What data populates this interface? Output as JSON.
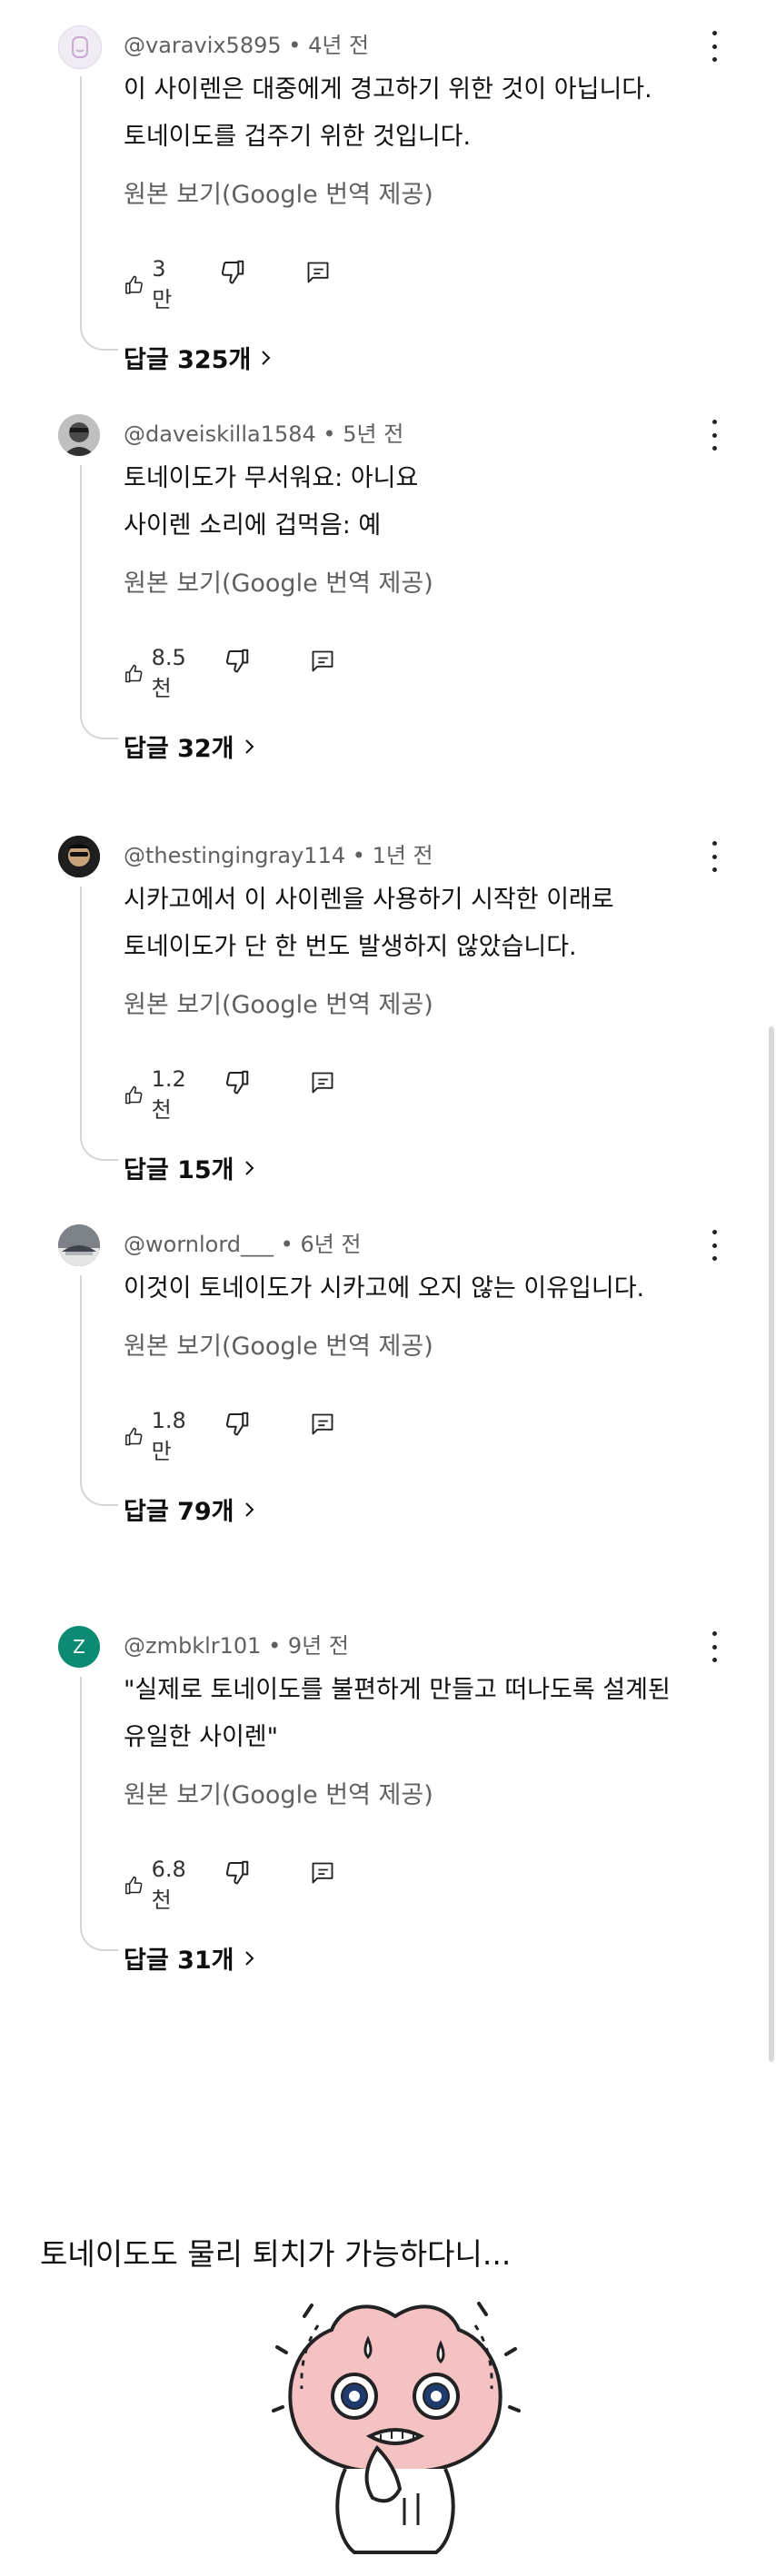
{
  "comments": [
    {
      "handle": "@varavix5895",
      "age": "4년 전",
      "lines": [
        "이 사이렌은 대중에게 경고하기 위한 것이 아닙니다.",
        "토네이도를 겁주기 위한 것입니다."
      ],
      "translate_label": "원본 보기(Google 번역 제공)",
      "likes": "3만",
      "replies_label": "답글 325개"
    },
    {
      "handle": "@daveiskilla1584",
      "age": "5년 전",
      "lines": [
        "토네이도가 무서워요: 아니요",
        "사이렌 소리에 겁먹음: 예"
      ],
      "translate_label": "원본 보기(Google 번역 제공)",
      "likes": "8.5천",
      "replies_label": "답글 32개"
    },
    {
      "handle": "@thestingingray114",
      "age": "1년 전",
      "lines": [
        "시카고에서 이 사이렌을 사용하기 시작한 이래로",
        "토네이도가 단 한 번도 발생하지 않았습니다."
      ],
      "translate_label": "원본 보기(Google 번역 제공)",
      "likes": "1.2천",
      "replies_label": "답글 15개"
    },
    {
      "handle": "@wornlord___",
      "age": "6년 전",
      "lines": [
        "이것이 토네이도가 시카고에 오지 않는 이유입니다."
      ],
      "translate_label": "원본 보기(Google 번역 제공)",
      "likes": "1.8만",
      "replies_label": "답글 79개"
    },
    {
      "handle": "@zmbklr101",
      "age": "9년 전",
      "avatar_letter": "Z",
      "lines": [
        "\"실제로 토네이도를 불편하게 만들고 떠나도록 설계된",
        "유일한 사이렌\""
      ],
      "translate_label": "원본 보기(Google 번역 제공)",
      "likes": "6.8천",
      "replies_label": "답글 31개"
    }
  ],
  "caption": "토네이도도 물리 퇴치가 가능하다니...",
  "icons": {
    "like": "thumbs-up-icon",
    "dislike": "thumbs-down-icon",
    "reply": "reply-icon",
    "menu": "more-vert-icon",
    "chevron": "chevron-right-icon"
  },
  "colors": {
    "text": "#0f0f0f",
    "secondary": "#606060",
    "thread": "#d6d6d6",
    "avatar_z": "#0d8a72",
    "peach": "#f5c2c4"
  }
}
